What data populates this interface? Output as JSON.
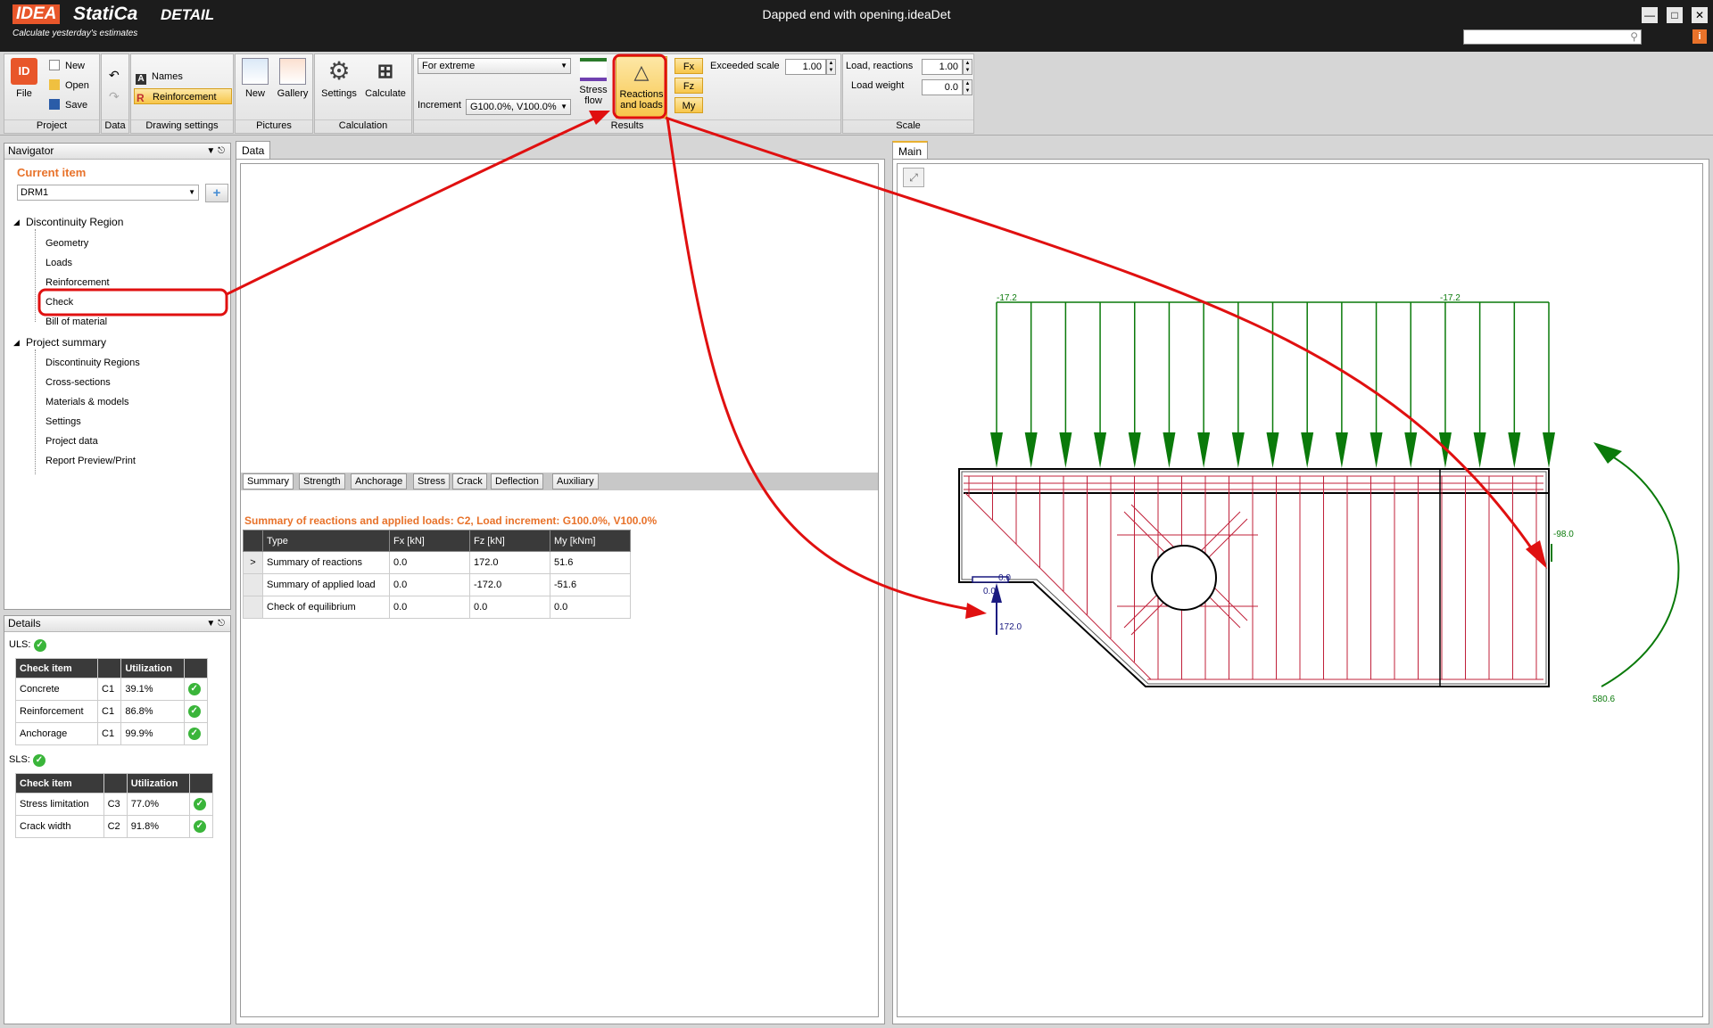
{
  "app": {
    "logo_idea": "IDEA",
    "logo_statica": "StatiCa",
    "logo_detail": "DETAIL",
    "tagline": "Calculate yesterday's estimates",
    "window_title": "Dapped end with opening.ideaDet"
  },
  "ribbon": {
    "project": {
      "label": "Project",
      "file": "File",
      "new": "New",
      "open": "Open",
      "save": "Save"
    },
    "data": {
      "label": "Data"
    },
    "drawing": {
      "label": "Drawing settings",
      "names": "Names",
      "reinforcement": "Reinforcement"
    },
    "pictures": {
      "label": "Pictures",
      "new": "New",
      "gallery": "Gallery"
    },
    "calculation": {
      "label": "Calculation",
      "settings": "Settings",
      "calculate": "Calculate"
    },
    "results": {
      "label": "Results",
      "extreme": "For extreme",
      "increment_label": "Increment",
      "increment_value": "G100.0%, V100.0%",
      "stress_flow_1": "Stress",
      "stress_flow_2": "flow",
      "reactions_1": "Reactions",
      "reactions_2": "and loads",
      "fx": "Fx",
      "fz": "Fz",
      "my": "My",
      "exceeded_label": "Exceeded scale",
      "exceeded_value": "1.00"
    },
    "scale": {
      "label": "Scale",
      "reactions_label": "Load, reactions",
      "reactions_value": "1.00",
      "weight_label": "Load weight",
      "weight_value": "0.0"
    }
  },
  "navigator": {
    "title": "Navigator",
    "current_item": "Current item",
    "selected_region": "DRM1",
    "root1": "Discontinuity Region",
    "root1_items": [
      "Geometry",
      "Loads",
      "Reinforcement",
      "Check",
      "Bill of material"
    ],
    "root2": "Project summary",
    "root2_items": [
      "Discontinuity Regions",
      "Cross-sections",
      "Materials & models",
      "Settings",
      "Project data",
      "Report Preview/Print"
    ]
  },
  "details": {
    "title": "Details",
    "uls_label": "ULS:",
    "sls_label": "SLS:",
    "headers": {
      "check": "Check item",
      "util": "Utilization"
    },
    "uls_rows": [
      {
        "item": "Concrete",
        "comb": "C1",
        "util": "39.1%"
      },
      {
        "item": "Reinforcement",
        "comb": "C1",
        "util": "86.8%"
      },
      {
        "item": "Anchorage",
        "comb": "C1",
        "util": "99.9%"
      }
    ],
    "sls_rows": [
      {
        "item": "Stress limitation",
        "comb": "C3",
        "util": "77.0%"
      },
      {
        "item": "Crack width",
        "comb": "C2",
        "util": "91.8%"
      }
    ]
  },
  "data_panel": {
    "tab": "Data",
    "result_tabs": [
      "Summary",
      "Strength",
      "Anchorage",
      "Stress",
      "Crack",
      "Deflection",
      "Auxiliary"
    ],
    "summary_title": "Summary of reactions and applied loads: C2, Load increment: G100.0%, V100.0%",
    "columns": [
      "Type",
      "Fx [kN]",
      "Fz [kN]",
      "My [kNm]"
    ],
    "rows": [
      {
        "type": "Summary of reactions",
        "fx": "0.0",
        "fz": "172.0",
        "my": "51.6"
      },
      {
        "type": "Summary of applied load",
        "fx": "0.0",
        "fz": "-172.0",
        "my": "-51.6"
      },
      {
        "type": "Check of equilibrium",
        "fx": "0.0",
        "fz": "0.0",
        "my": "0.0"
      }
    ]
  },
  "main_panel": {
    "tab": "Main",
    "labels": {
      "load_left": "-17.2",
      "load_right": "-17.2",
      "moment_right": "-98.0",
      "moment_value": "580.6",
      "support_a": "0.0",
      "support_b": "0.0",
      "reaction": "172.0"
    }
  },
  "colors": {
    "accent": "#e8722a",
    "load": "#0a7a0a",
    "rebar": "#c0203a",
    "annotation": "#e01010",
    "reaction": "#1a1a80"
  }
}
